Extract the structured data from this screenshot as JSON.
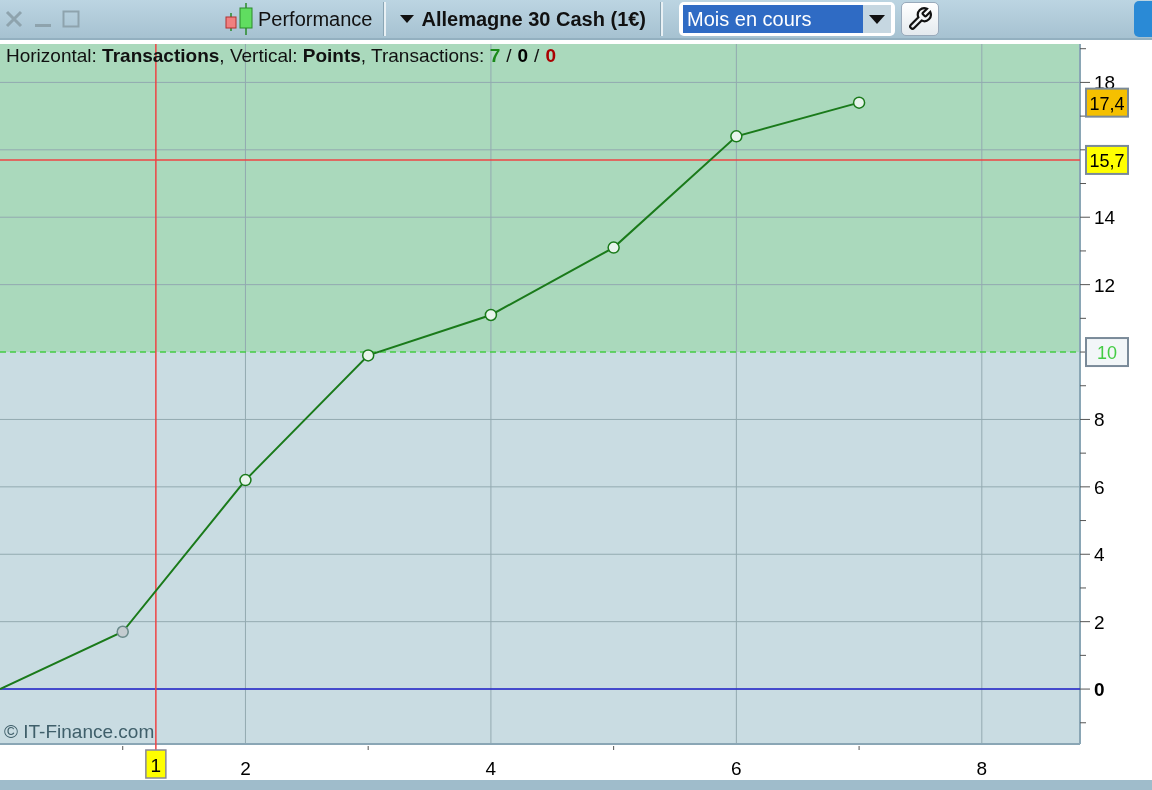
{
  "toolbar": {
    "title": "Performance",
    "instrument": "Allemagne 30 Cash (1€)",
    "period": "Mois en cours"
  },
  "chart": {
    "info": {
      "text": "Horizontal: **Transactions**, Vertical: **Points**, Transactions: ",
      "separator": "/",
      "counts": [
        {
          "value": "7",
          "color": "#1a8a1a"
        },
        {
          "value": "0",
          "color": "#000000"
        },
        {
          "value": "0",
          "color": "#aa0000"
        }
      ]
    },
    "watermark": "© IT-Finance.com",
    "chart_data": {
      "type": "line",
      "x": [
        0,
        1,
        2,
        3,
        4,
        5,
        6,
        7
      ],
      "series": [
        {
          "color": "#1a7a1a",
          "marker": "circle",
          "values": [
            0,
            1.7,
            6.2,
            9.9,
            11.1,
            13.1,
            16.4,
            17.4
          ]
        }
      ],
      "grid": true,
      "xlim": [
        0,
        8.8
      ],
      "ylim": [
        -1.63,
        19.14
      ],
      "xticks": [
        2,
        4,
        6,
        8
      ],
      "yticks": [
        {
          "value": 0,
          "label": "0"
        },
        2,
        4,
        6,
        8,
        12,
        14,
        18
      ],
      "bands": [
        {
          "axis": "y",
          "from": 10,
          "to": 19.14,
          "color": "#aad9bc"
        }
      ],
      "ref_lines": [
        {
          "axis": "y",
          "value": 10,
          "label": "10",
          "color": "#44cc44"
        },
        {
          "axis": "y",
          "value": 0,
          "color": "#2222cc"
        },
        {
          "axis": "x",
          "value": 1.27,
          "label": "1",
          "color": "#ee4444"
        },
        {
          "axis": "y",
          "value": 15.7,
          "label": "15,7",
          "color": "#ee4444"
        }
      ],
      "annotations": [
        {
          "text": "17,4"
        }
      ]
    }
  }
}
